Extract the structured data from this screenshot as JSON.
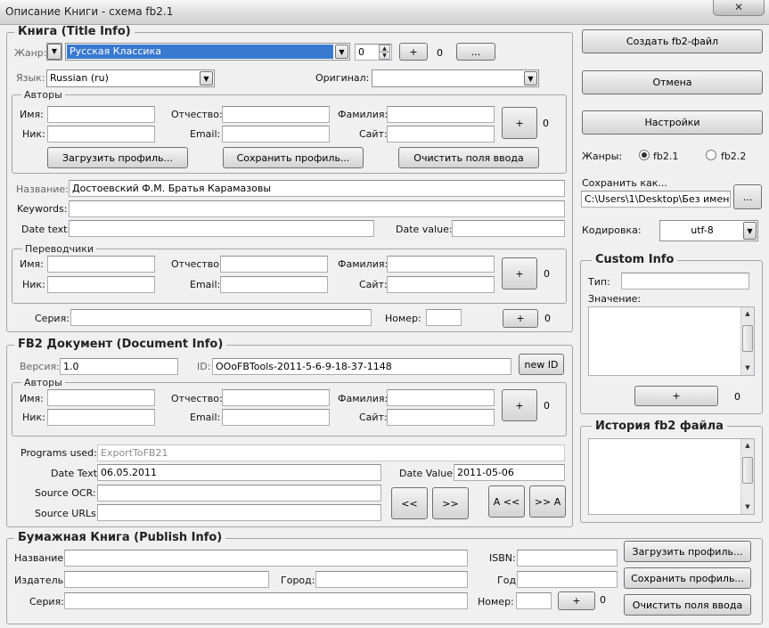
{
  "window": {
    "title": "Описание Книги - схема fb2.1",
    "close": "✕"
  },
  "title_info": {
    "group_title": "Книга (Title Info)",
    "genre_label": "Жанр:",
    "genre_prefix": "",
    "genre_value": "Русская Классика",
    "genre_num": "0",
    "genre_add": "+",
    "genre_count": "0",
    "genre_more": "...",
    "lang_label": "Язык:",
    "lang_value": "Russian (ru)",
    "orig_label": "Оригинал:",
    "orig_value": "",
    "authors": {
      "title": "Авторы",
      "name": "Имя:",
      "middle": "Отчество:",
      "last": "Фамилия:",
      "nick": "Ник:",
      "email": "Email:",
      "site": "Сайт:",
      "add": "+",
      "count": "0",
      "load": "Загрузить профиль...",
      "save": "Сохранить профиль...",
      "clear": "Очистить поля ввода"
    },
    "name_label": "Название:",
    "name_value": "Достоевский Ф.М. Братья Карамазовы",
    "keywords_label": "Keywords:",
    "date_text_label": "Date text:",
    "date_value_label": "Date value:",
    "translators": {
      "title": "Переводчики",
      "name": "Имя:",
      "middle": "Отчество:",
      "last": "Фамилия:",
      "nick": "Ник:",
      "email": "Email:",
      "site": "Сайт:",
      "add": "+",
      "count": "0"
    },
    "series_label": "Серия:",
    "number_label": "Номер:",
    "series_add": "+",
    "series_count": "0"
  },
  "document_info": {
    "group_title": "FB2 Документ (Document Info)",
    "version_label": "Версия:",
    "version_value": "1.0",
    "id_label": "ID:",
    "id_value": "OOoFBTools-2011-5-6-9-18-37-1148",
    "new_id": "new ID",
    "authors": {
      "title": "Авторы",
      "name": "Имя:",
      "middle": "Отчество:",
      "last": "Фамилия:",
      "nick": "Ник:",
      "email": "Email:",
      "site": "Сайт:",
      "add": "+",
      "count": "0"
    },
    "programs_label": "Programs used:",
    "programs_value": "ExportToFB21",
    "date_text_label": "Date Text:",
    "date_text_value": "06.05.2011",
    "date_value_label": "Date Value:",
    "date_value_value": "2011-05-06",
    "source_ocr_label": "Source OCR:",
    "source_urls_label": "Source URLs:",
    "btn_prev": "<<",
    "btn_next": ">>",
    "btn_a_prev": "A <<",
    "btn_a_next": ">> A"
  },
  "publish_info": {
    "group_title": "Бумажная Книга (Publish Info)",
    "name_label": "Название:",
    "isbn_label": "ISBN:",
    "publisher_label": "Издатель:",
    "city_label": "Город:",
    "year_label": "Год:",
    "series_label": "Серия:",
    "number_label": "Номер:",
    "add": "+",
    "count": "0",
    "load": "Загрузить профиль...",
    "save": "Сохранить профиль...",
    "clear": "Очистить поля ввода"
  },
  "sidebar": {
    "create": "Создать fb2-файл",
    "cancel": "Отмена",
    "settings": "Настройки",
    "genres_label": "Жанры:",
    "radio_fb21": "fb2.1",
    "radio_fb22": "fb2.2",
    "save_as_label": "Сохранить как...",
    "save_as_value": "C:\\Users\\1\\Desktop\\Без имени",
    "browse": "...",
    "encoding_label": "Кодировка:",
    "encoding_value": "utf-8",
    "custom_title": "Custom Info",
    "type_label": "Тип:",
    "value_label": "Значение:",
    "custom_add": "+",
    "custom_count": "0",
    "history_title": "История fb2 файла"
  }
}
